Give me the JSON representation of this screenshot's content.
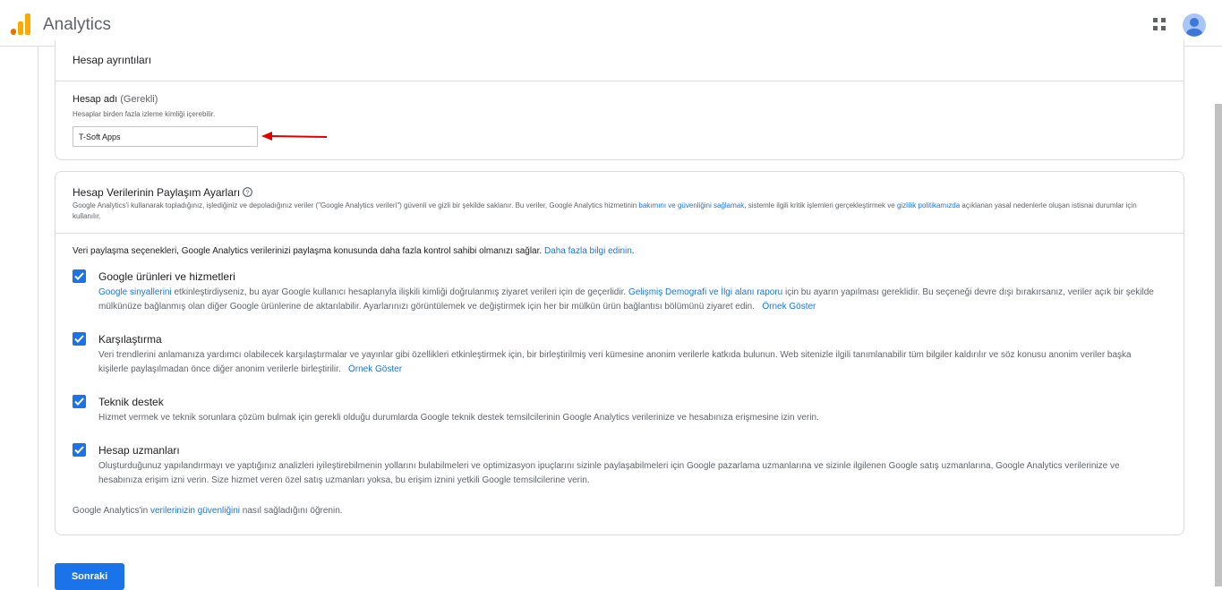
{
  "app": {
    "title": "Analytics",
    "accent": "#1a73e8",
    "logo_colors": [
      "#f9ab00",
      "#e37400"
    ]
  },
  "header": {
    "apps_icon": "apps-grid-icon",
    "avatar_icon": "account-avatar-icon"
  },
  "account_details": {
    "section_title": "Hesap ayrıntıları",
    "field_label": "Hesap adı",
    "field_required": "(Gerekli)",
    "field_help": "Hesaplar birden fazla izleme kimliği içerebilir.",
    "field_value": "T-Soft Apps",
    "annotation": "red-arrow-pointing-left"
  },
  "sharing": {
    "section_title": "Hesap Verilerinin Paylaşım Ayarları",
    "desc_part1": "Google Analytics'i kullanarak topladığınız, işlediğiniz ve depoladığınız veriler (\"Google Analytics verileri\") güvenli ve gizli bir şekilde saklanır. Bu veriler, Google Analytics hizmetinin ",
    "desc_link1": "bakımını ve güvenliğini sağlamak",
    "desc_part2": ", sistemle ilgili kritik işlemleri gerçekleştirmek ve ",
    "desc_link2": "gizlilik politikamızda",
    "desc_part3": " açıklanan yasal nedenlerle oluşan istisnai durumlar için kullanılır.",
    "intro_text": "Veri paylaşma seçenekleri, Google Analytics verilerinizi paylaşma konusunda daha fazla kontrol sahibi olmanızı sağlar. ",
    "intro_link": "Daha fazla bilgi edinin",
    "intro_end": ".",
    "options": [
      {
        "title": "Google ürünleri ve hizmetleri",
        "checked": true,
        "link_a": "Google sinyallerini",
        "text_a": " etkinleştirdiyseniz, bu ayar Google kullanıcı hesaplarıyla ilişkili kimliği doğrulanmış ziyaret verileri için de geçerlidir. ",
        "link_b": "Gelişmiş Demografi ve İlgi alanı raporu",
        "text_b": " için bu ayarın yapılması gereklidir. Bu seçeneği devre dışı bırakırsanız, veriler açık bir şekilde mülkünüze bağlanmış olan diğer Google ürünlerine de aktarılabilir. Ayarlarınızı görüntülemek ve değiştirmek için her bir mülkün ürün bağlantısı bölümünü ziyaret edin.",
        "example_link": "Örnek Göster"
      },
      {
        "title": "Karşılaştırma",
        "checked": true,
        "text": "Veri trendlerini anlamanıza yardımcı olabilecek karşılaştırmalar ve yayınlar gibi özellikleri etkinleştirmek için, bir birleştirilmiş veri kümesine anonim verilerle katkıda bulunun. Web sitenizle ilgili tanımlanabilir tüm bilgiler kaldırılır ve söz konusu anonim veriler başka kişilerle paylaşılmadan önce diğer anonim verilerle birleştirilir.",
        "example_link": "Örnek Göster"
      },
      {
        "title": "Teknik destek",
        "checked": true,
        "text": "Hizmet vermek ve teknik sorunlara çözüm bulmak için gerekli olduğu durumlarda Google teknik destek temsilcilerinin Google Analytics verilerinize ve hesabınıza erişmesine izin verin."
      },
      {
        "title": "Hesap uzmanları",
        "checked": true,
        "text": "Oluşturduğunuz yapılandırmayı ve yaptığınız analizleri iyileştirebilmenin yollarını bulabilmeleri ve optimizasyon ipuçlarını sizinle paylaşabilmeleri için Google pazarlama uzmanlarına ve sizinle ilgilenen Google satış uzmanlarına, Google Analytics verilerinize ve hesabınıza erişim izni verin. Size hizmet veren özel satış uzmanları yoksa, bu erişim iznini yetkili Google temsilcilerine verin."
      }
    ],
    "footer_pre": "Google Analytics'in ",
    "footer_link": "verilerinizin güvenliğini",
    "footer_post": " nasıl sağladığını öğrenin."
  },
  "next_button": "Sonraki"
}
